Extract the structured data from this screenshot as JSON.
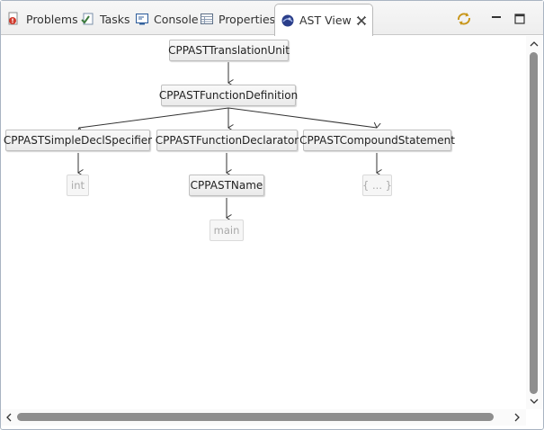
{
  "tabs": [
    {
      "label": "Problems",
      "icon": "problems-icon"
    },
    {
      "label": "Tasks",
      "icon": "tasks-icon"
    },
    {
      "label": "Console",
      "icon": "console-icon"
    },
    {
      "label": "Properties",
      "icon": "properties-icon"
    },
    {
      "label": "AST View",
      "icon": "ast-view-icon",
      "active": true
    }
  ],
  "toolbar": {
    "sync_icon": "sync-icon",
    "minimize_icon": "minimize-icon",
    "maximize_icon": "maximize-icon"
  },
  "ast": {
    "root": "CPPASTTranslationUnit",
    "function_definition": "CPPASTFunctionDefinition",
    "decl_specifier": "CPPASTSimpleDeclSpecifier",
    "function_declarator": "CPPASTFunctionDeclarator",
    "compound_statement": "CPPASTCompoundStatement",
    "name": "CPPASTName",
    "leaf_int": "int",
    "leaf_main": "main",
    "leaf_body": "{ ... }"
  },
  "colors": {
    "accent_sync": "#d4a017",
    "scroll_thumb": "#8e8e8e",
    "node_border": "#c0c0c0"
  }
}
